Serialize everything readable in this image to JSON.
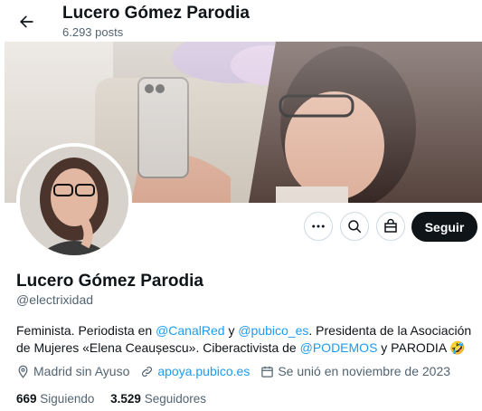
{
  "header": {
    "title": "Lucero Gómez Parodia",
    "posts": "6.293 posts"
  },
  "profile": {
    "name": "Lucero Gómez Parodia",
    "handle": "@electrixidad",
    "follow_label": "Seguir",
    "bio": {
      "p1": "Feminista. Periodista en ",
      "m1": "@CanalRed",
      "p2": " y ",
      "m2": "@pubico_es",
      "p3": ". Presidenta de la Asociación de Mujeres «Elena Ceaușescu». Ciberactivista de ",
      "m3": "@PODEMOS",
      "p4": " y PARODIA ",
      "emoji": "🤣"
    },
    "location": "Madrid sin Ayuso",
    "website": "apoya.pubico.es",
    "joined": "Se unió en noviembre de 2023",
    "following_count": "669",
    "following_label": "Siguiendo",
    "followers_count": "3.529",
    "followers_label": "Seguidores"
  },
  "icons": [
    "back-arrow-icon",
    "more-icon",
    "search-icon",
    "shop-icon",
    "location-icon",
    "link-icon",
    "calendar-icon"
  ]
}
